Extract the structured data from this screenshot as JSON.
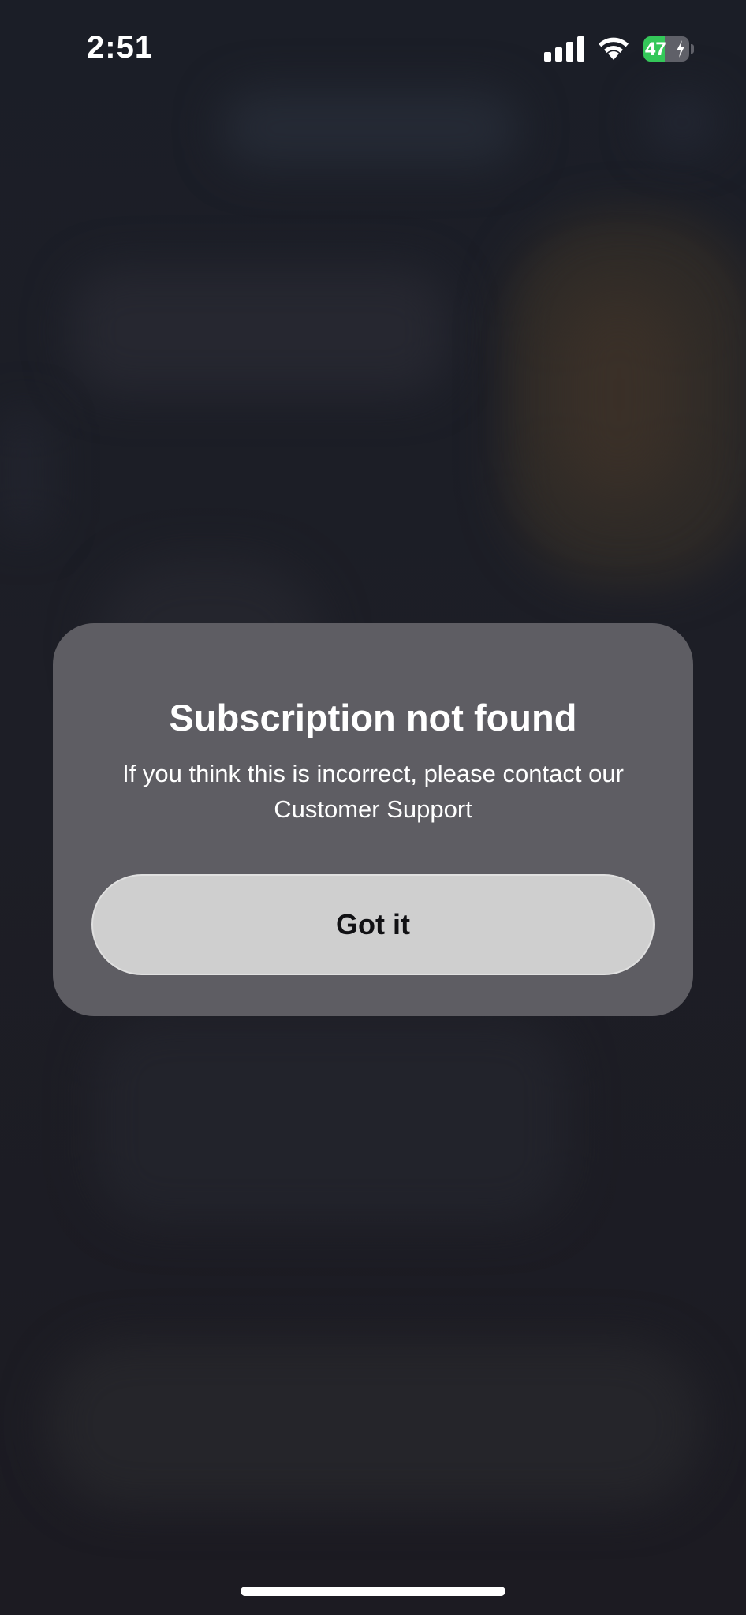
{
  "status_bar": {
    "time": "2:51",
    "battery_percent": "47",
    "battery_level": 0.47,
    "charging": true
  },
  "dialog": {
    "title": "Subscription not found",
    "message": "If you think this is incorrect, please contact our Customer Support",
    "button_label": "Got it"
  },
  "colors": {
    "background": "#1c1d24",
    "dialog_background": "#5e5d63",
    "button_background": "#cfcfcf",
    "battery_fill": "#34c759"
  },
  "icons": [
    "cellular-signal-icon",
    "wifi-icon",
    "battery-icon",
    "charging-bolt-icon"
  ]
}
